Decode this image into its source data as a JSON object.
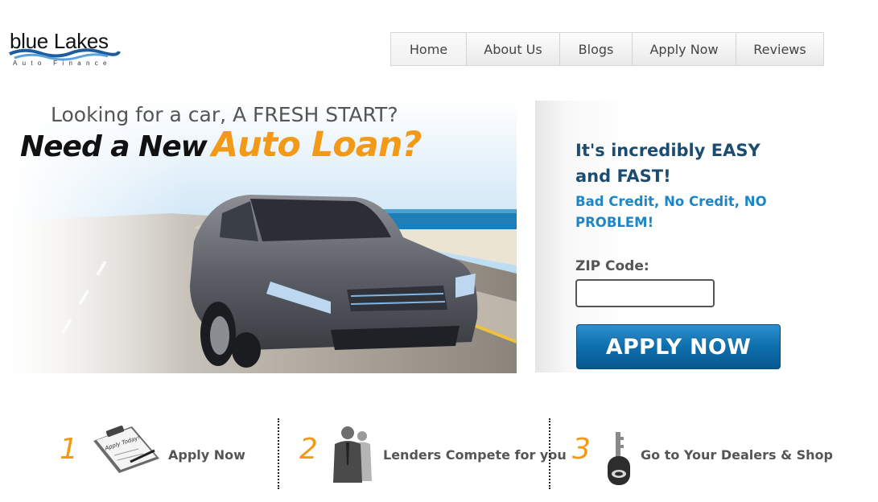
{
  "logo": {
    "name": "blue Lakes",
    "tagline": "Auto Finance",
    "colors": {
      "wave_dark": "#1f5c9e",
      "wave_light": "#5aa3de"
    }
  },
  "nav": {
    "items": [
      {
        "label": "Home"
      },
      {
        "label": "About Us"
      },
      {
        "label": "Blogs"
      },
      {
        "label": "Apply Now"
      },
      {
        "label": "Reviews"
      }
    ]
  },
  "hero": {
    "subtitle": "Looking for a car, A FRESH START?",
    "title_part1": "Need a New",
    "title_part2": "Auto Loan?",
    "image": "silver-sedan-on-coastal-road"
  },
  "apply_panel": {
    "headline": "It's incredibly EASY and FAST!",
    "subheadline": "Bad Credit, No Credit, NO PROBLEM!",
    "zip_label": "ZIP Code:",
    "zip_value": "",
    "button_label": "APPLY NOW"
  },
  "steps": [
    {
      "number": "1",
      "label": "Apply Now",
      "icon": "clipboard-icon"
    },
    {
      "number": "2",
      "label": "Lenders Compete for you",
      "icon": "businessmen-icon"
    },
    {
      "number": "3",
      "label": "Go to Your Dealers & Shop",
      "icon": "car-key-icon"
    }
  ],
  "clipboard_note": "Apply Today!",
  "colors": {
    "accent_orange": "#f29a18",
    "headline_navy": "#1c4d70",
    "subheadline_blue": "#1d86c6",
    "button_blue": "#0e6fae"
  }
}
